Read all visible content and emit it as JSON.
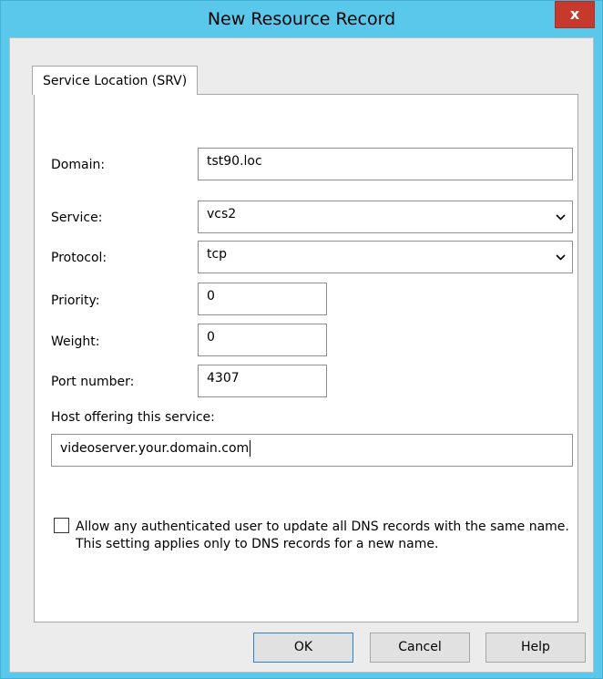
{
  "window": {
    "title": "New Resource Record",
    "close_label": "x"
  },
  "tab": {
    "label": "Service Location (SRV)"
  },
  "form": {
    "domain_label": "Domain:",
    "domain_value": "tst90.loc",
    "service_label": "Service:",
    "service_value": "vcs2",
    "protocol_label": "Protocol:",
    "protocol_value": "tcp",
    "priority_label": "Priority:",
    "priority_value": "0",
    "weight_label": "Weight:",
    "weight_value": "0",
    "port_label": "Port number:",
    "port_value": "4307",
    "host_label": "Host offering this service:",
    "host_value": "videoserver.your.domain.com"
  },
  "checkbox": {
    "label": "Allow any authenticated user to update all DNS records with the same name. This setting applies only to DNS records for a new name.",
    "checked": false
  },
  "buttons": {
    "ok": "OK",
    "cancel": "Cancel",
    "help": "Help"
  },
  "icons": {
    "close": "close-icon",
    "dropdown": "chevron-down-icon"
  },
  "colors": {
    "title_bar": "#5ac8ea",
    "close_button": "#c7392c",
    "client": "#ececec"
  }
}
